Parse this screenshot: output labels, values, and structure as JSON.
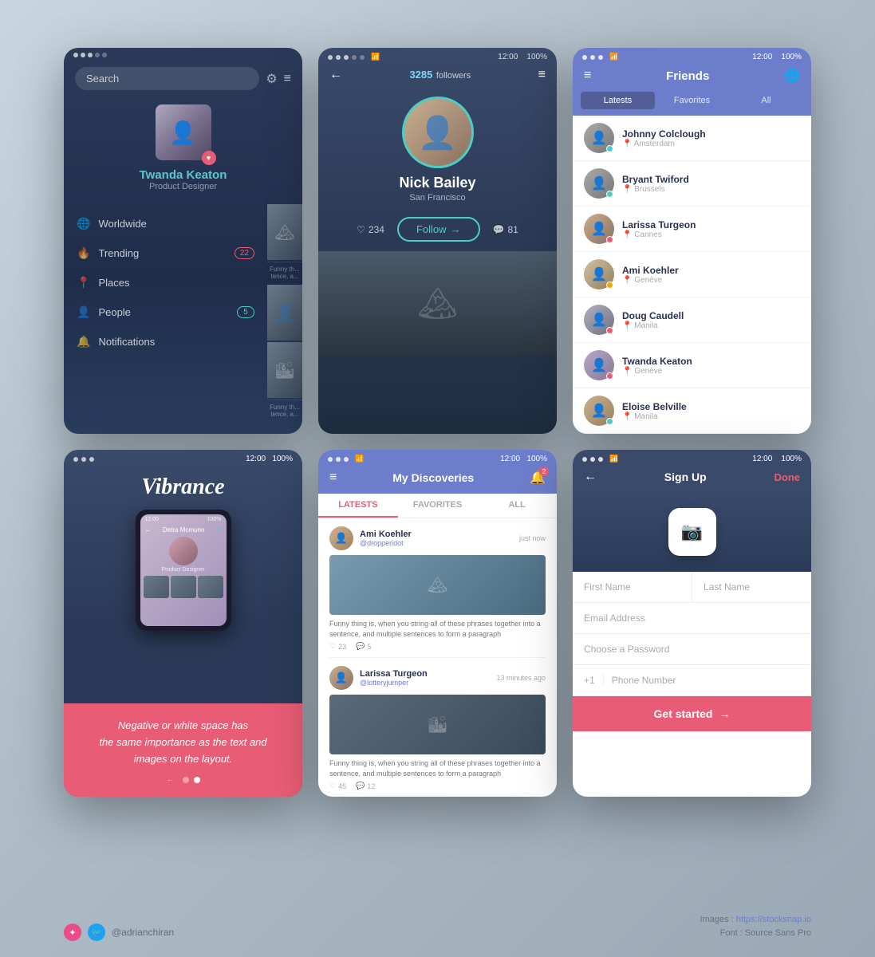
{
  "footer": {
    "handle": "@adrianchiran",
    "images_label": "Images :",
    "images_url": "https://stocksnap.io",
    "font_label": "Font :",
    "font_name": "Source Sans Pro"
  },
  "card1": {
    "search_placeholder": "Search",
    "user_name": "Twanda Keaton",
    "user_role": "Product Designer",
    "nav": [
      {
        "icon": "🌐",
        "label": "Worldwide",
        "badge": null,
        "badge_type": null
      },
      {
        "icon": "🔥",
        "label": "Trending",
        "badge": "22",
        "badge_type": "red"
      },
      {
        "icon": "📍",
        "label": "Places",
        "badge": null,
        "badge_type": null
      },
      {
        "icon": "👤",
        "label": "People",
        "badge": "5",
        "badge_type": "teal"
      },
      {
        "icon": "🔔",
        "label": "Notifications",
        "badge": null,
        "badge_type": null
      }
    ],
    "thumbs": [
      {
        "text": "Funny th... tence, a..."
      },
      {
        "text": ""
      },
      {
        "text": "Funny th... tence, a..."
      }
    ]
  },
  "card2": {
    "status_left": "●●●○○",
    "time": "12:00",
    "battery": "100%",
    "followers_count": "3285",
    "followers_label": "followers",
    "name": "Nick Bailey",
    "location": "San Francisco",
    "likes": "234",
    "follow_label": "Follow",
    "comments": "81"
  },
  "card3": {
    "time": "12:00",
    "battery": "100%",
    "title": "Friends",
    "tabs": [
      "Latests",
      "Favorites",
      "All"
    ],
    "friends": [
      {
        "name": "Johnny Colclough",
        "location": "Amsterdam",
        "status": "green"
      },
      {
        "name": "Bryant Twiford",
        "location": "Brussels",
        "status": "green"
      },
      {
        "name": "Larissa Turgeon",
        "location": "Cannes",
        "status": "red"
      },
      {
        "name": "Ami Koehler",
        "location": "Genève",
        "status": "orange"
      },
      {
        "name": "Doug Caudell",
        "location": "Manila",
        "status": "red"
      },
      {
        "name": "Twanda Keaton",
        "location": "Genève",
        "status": "red"
      },
      {
        "name": "Eloise Belville",
        "location": "Manila",
        "status": "green"
      }
    ]
  },
  "card4": {
    "brand": "Vibrance",
    "tagline": "Negative or white space has\nthe same importance as the text and\nimages on the layout.",
    "inner_name": "Detra Mcmunn",
    "inner_role": "Product Designer"
  },
  "card5": {
    "title": "My Discoveries",
    "tabs": [
      "LATESTS",
      "FAVORITES",
      "ALL"
    ],
    "notif_count": "2",
    "posts": [
      {
        "author": "Ami Koehler",
        "handle": "@dropperidot",
        "time": "just now",
        "likes": "23",
        "comments": "5",
        "text": "Funny thing is, when you string all of these phrases together into a sentence, and multiple sentences to form a paragraph"
      },
      {
        "author": "Larissa Turgeon",
        "handle": "@lotteryjumper",
        "time": "13 minutes ago",
        "likes": "45",
        "comments": "12",
        "text": "Funny thing is, when you string all of these phrases together into a sentence, and multiple sentences to form a paragraph"
      }
    ]
  },
  "card6": {
    "time": "12:00",
    "battery": "100%",
    "title": "Sign Up",
    "done_label": "Done",
    "fields": {
      "first_name": "First Name",
      "last_name": "Last Name",
      "email": "Email Address",
      "password": "Choose a Password",
      "country_code": "+1",
      "phone": "Phone Number"
    },
    "submit_label": "Get started"
  }
}
